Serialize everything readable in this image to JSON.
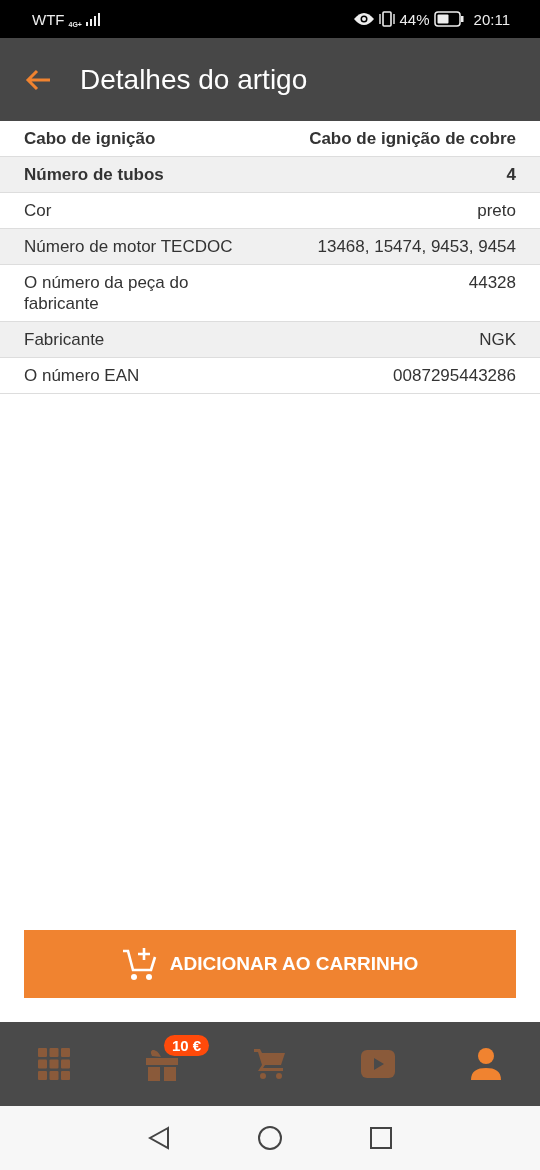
{
  "status_bar": {
    "carrier": "WTF",
    "network": "4G+",
    "battery": "44%",
    "time": "20:11"
  },
  "app_bar": {
    "title": "Detalhes do artigo"
  },
  "specs": [
    {
      "label": "Cabo de ignição",
      "value": "Cabo de ignição de cobre",
      "bold": true
    },
    {
      "label": "Número de tubos",
      "value": "4",
      "bold": true
    },
    {
      "label": "Cor",
      "value": "preto",
      "bold": false
    },
    {
      "label": "Número de motor TECDOC",
      "value": "13468, 15474, 9453, 9454",
      "bold": false
    },
    {
      "label": "O número da peça do fabricante",
      "value": "44328",
      "bold": false
    },
    {
      "label": "Fabricante",
      "value": "NGK",
      "bold": false
    },
    {
      "label": "O número EAN",
      "value": "0087295443286",
      "bold": false
    }
  ],
  "add_to_cart_button": {
    "label": "ADICIONAR AO CARRINHO"
  },
  "bottom_nav": [
    {
      "kind": "grid",
      "selected": false
    },
    {
      "kind": "gift",
      "selected": false,
      "badge": "10 €"
    },
    {
      "kind": "cart",
      "selected": false
    },
    {
      "kind": "video",
      "selected": false
    },
    {
      "kind": "profile",
      "selected": true
    }
  ]
}
